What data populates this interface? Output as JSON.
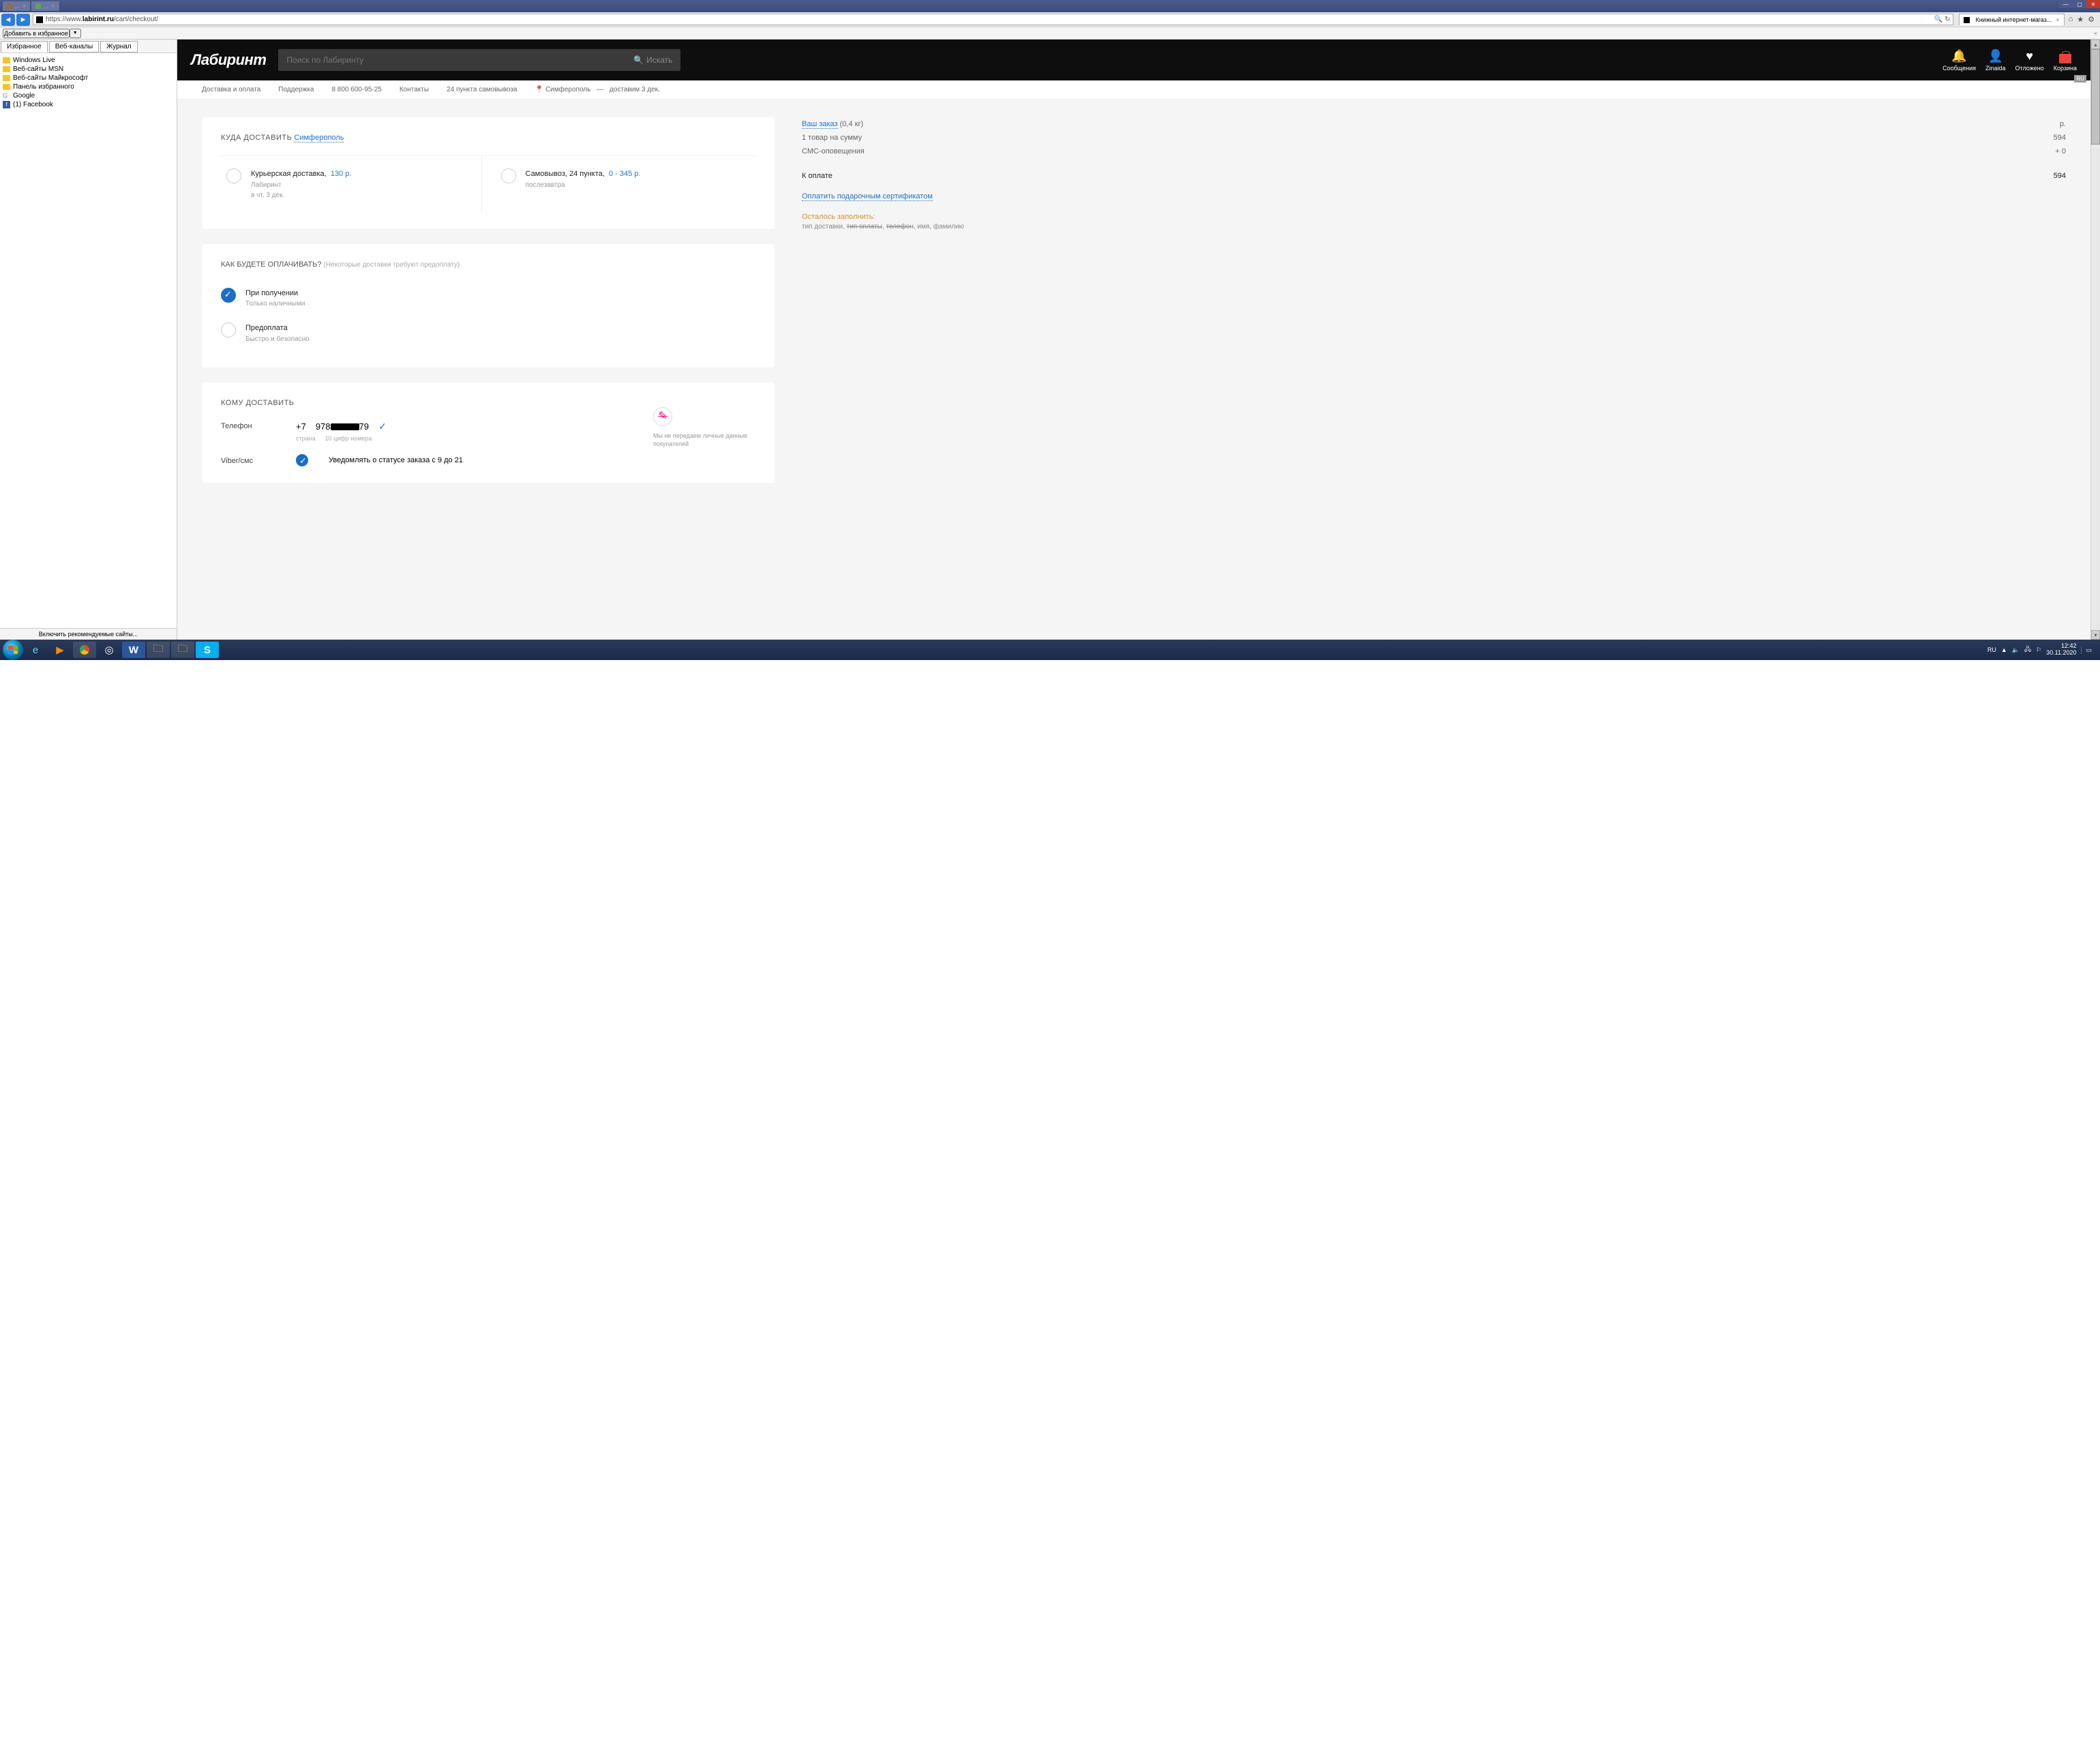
{
  "window": {
    "tabs_top": [
      {
        "label": "",
        "active": false
      },
      {
        "label": "",
        "active": false
      }
    ],
    "win_min": "—",
    "win_max": "▢",
    "win_close": "✕"
  },
  "nav": {
    "url_prefix": "https://www.",
    "url_bold": "labirint.ru",
    "url_rest": "/cart/checkout/",
    "search_glyph": "🔍",
    "refresh_glyph": "↻",
    "tab_title": "Книжный интернет-магаз...",
    "tab_close": "×",
    "home_glyph": "⌂",
    "star_glyph": "★",
    "gear_glyph": "⚙"
  },
  "favbar": {
    "add": "Добавить в избранное",
    "drop": "▼",
    "close": "×"
  },
  "sidebar": {
    "tabs": [
      "Избранное",
      "Веб-каналы",
      "Журнал"
    ],
    "active_tab": 0,
    "items": [
      {
        "label": "Windows Live",
        "type": "folder"
      },
      {
        "label": "Веб-сайты MSN",
        "type": "folder"
      },
      {
        "label": "Веб-сайты Майкрософт",
        "type": "folder"
      },
      {
        "label": "Панель избранного",
        "type": "folder"
      },
      {
        "label": "Google",
        "type": "google"
      },
      {
        "label": "(1) Facebook",
        "type": "fb"
      }
    ],
    "footer": "Включить рекомендуемые сайты..."
  },
  "site": {
    "logo": "Лабиринт",
    "search_placeholder": "Поиск по Лабиринту",
    "search_button": "Искать",
    "nav_icons": [
      {
        "label": "Сообщения",
        "glyph": "🔔"
      },
      {
        "label": "Zinaida",
        "glyph": "👤"
      },
      {
        "label": "Отложено",
        "glyph": "♥"
      },
      {
        "label": "Корзина",
        "glyph": "cart"
      }
    ],
    "lang": "RU"
  },
  "subnav": {
    "delivery": "Доставка и оплата",
    "support": "Поддержка",
    "phone": "8 800 600-95-25",
    "contacts": "Контакты",
    "pickup": "24 пункта самовывоза",
    "loc_icon": "📍",
    "city": "Симферополь",
    "dash": "—",
    "eta": "доставим 3 дек."
  },
  "checkout": {
    "dest_title": "КУДА ДОСТАВИТЬ",
    "dest_city": "Симферополь",
    "opt1": {
      "title": "Курьерская доставка,",
      "price": "130 р.",
      "brand": "Лабиринт",
      "eta": "в чт, 3 дек."
    },
    "opt2": {
      "title": "Самовывоз, 24 пункта,",
      "price": "0 - 345 р.",
      "eta": "послезавтра"
    },
    "pay_title": "КАК БУДЕТЕ ОПЛАЧИВАТЬ?",
    "pay_hint": "(Некоторые доставки требуют предоплату)",
    "pay1": {
      "title": "При получении",
      "sub": "Только наличными"
    },
    "pay2": {
      "title": "Предоплата",
      "sub": "Быстро и безопасно"
    },
    "rec_title": "КОМУ ДОСТАВИТЬ",
    "phone_label": "Телефон",
    "cc": "+7",
    "num_a": "978",
    "num_b": "79",
    "check": "✓",
    "hint_country": "страна",
    "hint_digits": "10 цифр номера",
    "viber_label": "Viber/смс",
    "viber_text": "Уведомлять о статусе заказа с 9 до 21",
    "notice_icon": "✎",
    "notice": "Мы не передаем личные данные покупателей"
  },
  "summary": {
    "order_label": "Ваш заказ",
    "order_weight": "(0,4 кг)",
    "rub": "р.",
    "line1_label": "1 товар на сумму",
    "line1_val": "594",
    "line2_label": "СМС-оповещения",
    "line2_val": "+ 0",
    "total_label": "К оплате",
    "total_val": "594",
    "gift": "Оплатить подарочным сертификатом",
    "todo_title": "Осталось заполнить:",
    "todo_items": "тип доставки, <span class=\"strike\">тип оплаты</span>, <span class=\"strike\">телефон</span>, имя, фамилию"
  },
  "taskbar": {
    "lang": "RU",
    "time": "12:42",
    "date": "30.11.2020",
    "tray_glyphs": [
      "▲",
      "🔈",
      "🖧",
      "⚐",
      "▭"
    ]
  }
}
